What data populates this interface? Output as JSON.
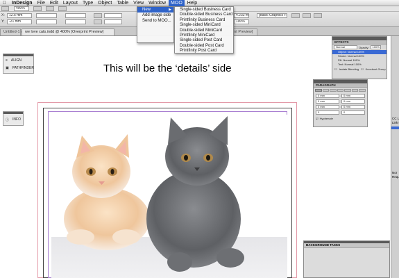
{
  "menubar": {
    "app": "InDesign",
    "items": [
      "File",
      "Edit",
      "Layout",
      "Type",
      "Object",
      "Table",
      "View",
      "Window",
      "MOO",
      "Help"
    ],
    "active": "MOO"
  },
  "control": {
    "zoom": "400%",
    "x_label": "X:",
    "x_value": "12.5 mm",
    "y_label": "Y:",
    "y_value": "-21 mm",
    "w_value": "4.233 mm",
    "percent": "100%",
    "frame_style": "[Basic Graphics Frame]"
  },
  "tabs": [
    {
      "label": "Untitled-1 @ 100%",
      "state": "inactive"
    },
    {
      "label": "we love cats.indd @ 400% [Overprint Preview]",
      "state": "active"
    },
    {
      "label": "int Preview]",
      "state": "inactive"
    }
  ],
  "moo_menu": {
    "items": [
      {
        "label": "New",
        "has_submenu": true,
        "active": true
      },
      {
        "label": "Add image side",
        "has_submenu": false,
        "active": false
      },
      {
        "label": "Send to MOO...",
        "has_submenu": false,
        "active": false
      }
    ],
    "submenu": [
      "Single-sided Business Card",
      "Double-sided Business Card",
      "Printfinity Business Card",
      "Single-sided MiniCard",
      "Double-sided MiniCard",
      "Printfinity MiniCard",
      "Single-sided Post Card",
      "Double-sided Post Card",
      "Printfinity Post Card"
    ]
  },
  "side_panels": {
    "align": "ALIGN",
    "pathfinder": "PATHFINDER",
    "info": "INFO"
  },
  "effects_panel": {
    "title": "EFFECTS",
    "blend_mode": "Normal",
    "opacity_label": "Opacity:",
    "opacity_value": "100%",
    "rows": [
      {
        "label": "Object: Normal 100%",
        "highlight": true
      },
      {
        "label": "Stroke:  Normal 100%",
        "highlight": false
      },
      {
        "label": "Fill:    Normal 100%",
        "highlight": false
      },
      {
        "label": "Text:    Normal 100%",
        "highlight": false
      }
    ],
    "isolate_blending": "Isolate Blending",
    "knockout_group": "Knockout Group"
  },
  "paragraph_panel": {
    "title": "PARAGRAPH",
    "fields": [
      "0 mm",
      "0 mm",
      "0 mm",
      "0 mm",
      "0 mm",
      "0 mm",
      "0",
      "0"
    ],
    "hyphenate": "Hyphenate"
  },
  "document": {
    "heading": "This will be the ‘details’ side"
  },
  "background_tasks": {
    "title": "BACKGROUND TASKS"
  },
  "right_strip": {
    "items": [
      "CC L",
      "Link to Ti",
      "Nor",
      "Requ"
    ]
  },
  "colors": {
    "menu_highlight": "#2f63c9",
    "bleed_guide": "#e39aa8",
    "margin_guide": "#a97fd1",
    "selection_row": "#3a6ad4"
  }
}
